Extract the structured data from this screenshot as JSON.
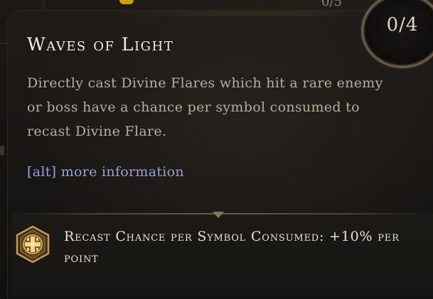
{
  "skill": {
    "title": "Waves of Light",
    "points": "0/4",
    "description": "Directly cast Divine Flares which hit a rare enemy or boss have a chance per symbol consumed to recast Divine Flare.",
    "more_info": "[alt] more information"
  },
  "stat": {
    "label": "Recast Chance per Symbol Consumed: +10% per point",
    "icon": "holy-symbol-icon"
  },
  "background": {
    "peek_text": "0/5"
  },
  "colors": {
    "title": "#f1ece2",
    "description": "#b7ae9f",
    "more_info": "#9aa0d6",
    "gold_border": "#6a5c47"
  }
}
